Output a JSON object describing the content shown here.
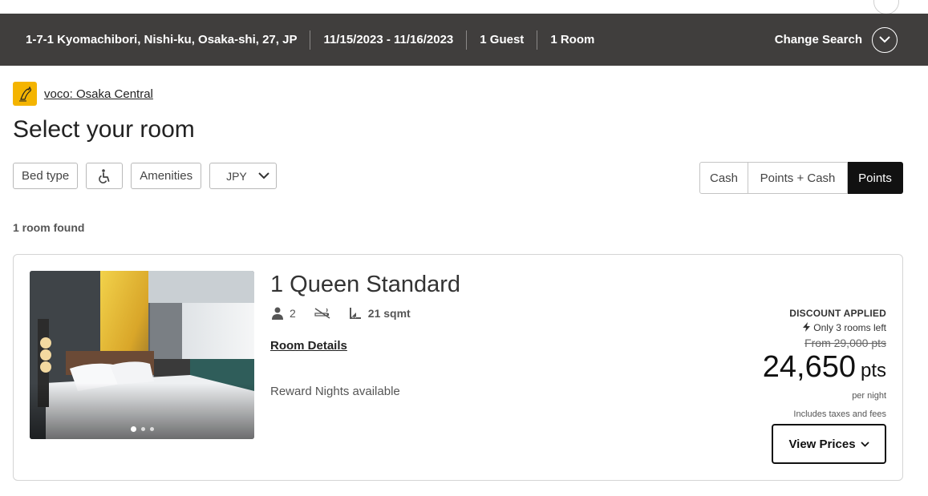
{
  "search": {
    "address": "1-7-1 Kyomachibori, Nishi-ku, Osaka-shi, 27, JP",
    "dates": "11/15/2023 - 11/16/2023",
    "guests": "1 Guest",
    "rooms": "1 Room",
    "change_label": "Change Search"
  },
  "hotel": {
    "name": "voco: Osaka Central",
    "logo_icon": "voco-bird-logo",
    "logo_color": "#f4b400"
  },
  "page": {
    "title": "Select your room"
  },
  "filters": {
    "bed_type": "Bed type",
    "accessible_icon": "wheelchair-icon",
    "amenities": "Amenities",
    "currency": "JPY"
  },
  "payment": {
    "options": [
      "Cash",
      "Points + Cash",
      "Points"
    ],
    "selected": "Points"
  },
  "results": {
    "count_text": "1 room found"
  },
  "room": {
    "name": "1 Queen Standard",
    "occupancy": "2",
    "size": "21 sqmt",
    "details_link": "Room Details",
    "reward_text": "Reward Nights available",
    "photo_count": 3,
    "photo_active_index": 0,
    "pricing": {
      "discount": "DISCOUNT APPLIED",
      "availability": "Only 3 rooms left",
      "original": "From 29,000 pts",
      "amount": "24,650",
      "unit": "pts",
      "per": "per night",
      "taxes": "Includes taxes and fees"
    },
    "view_prices": "View Prices"
  },
  "colors": {
    "header_bg": "#403e3d",
    "selected_toggle": "#111111"
  }
}
